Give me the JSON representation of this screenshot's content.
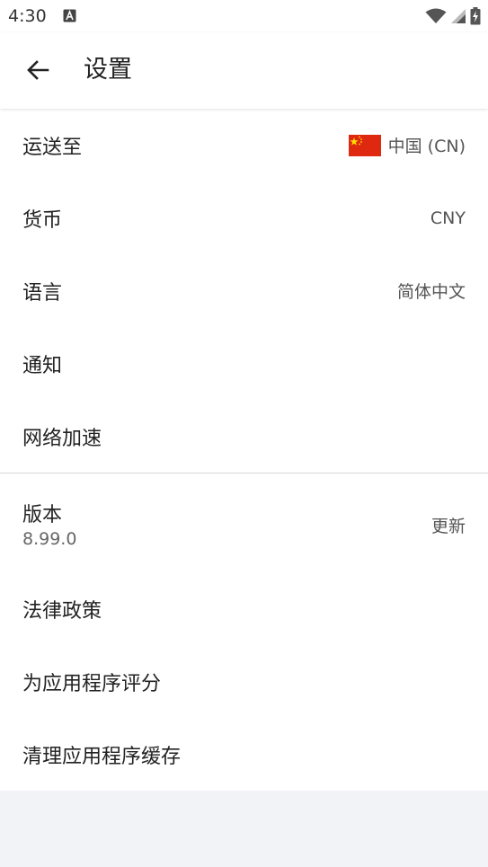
{
  "status_bar": {
    "time": "4:30",
    "notification_icon": "a-notification-icon",
    "wifi_icon": "wifi-icon",
    "signal_icon": "signal-icon",
    "battery_icon": "battery-charging-icon"
  },
  "app_bar": {
    "back_icon": "arrow-left-icon",
    "title": "设置"
  },
  "settings": {
    "ship_to": {
      "label": "运送至",
      "value": "中国 (CN)",
      "flag_icon": "china-flag-icon"
    },
    "currency": {
      "label": "货币",
      "value": "CNY"
    },
    "language": {
      "label": "语言",
      "value": "简体中文"
    },
    "notifications": {
      "label": "通知"
    },
    "network_acceleration": {
      "label": "网络加速"
    },
    "version": {
      "label": "版本",
      "number": "8.99.0",
      "action": "更新"
    },
    "legal_policy": {
      "label": "法律政策"
    },
    "rate_app": {
      "label": "为应用程序评分"
    },
    "clear_cache": {
      "label": "清理应用程序缓存"
    }
  },
  "colors": {
    "background": "#f2f3f7",
    "surface": "#ffffff",
    "flag_red": "#de2910",
    "flag_star": "#ffde00"
  }
}
